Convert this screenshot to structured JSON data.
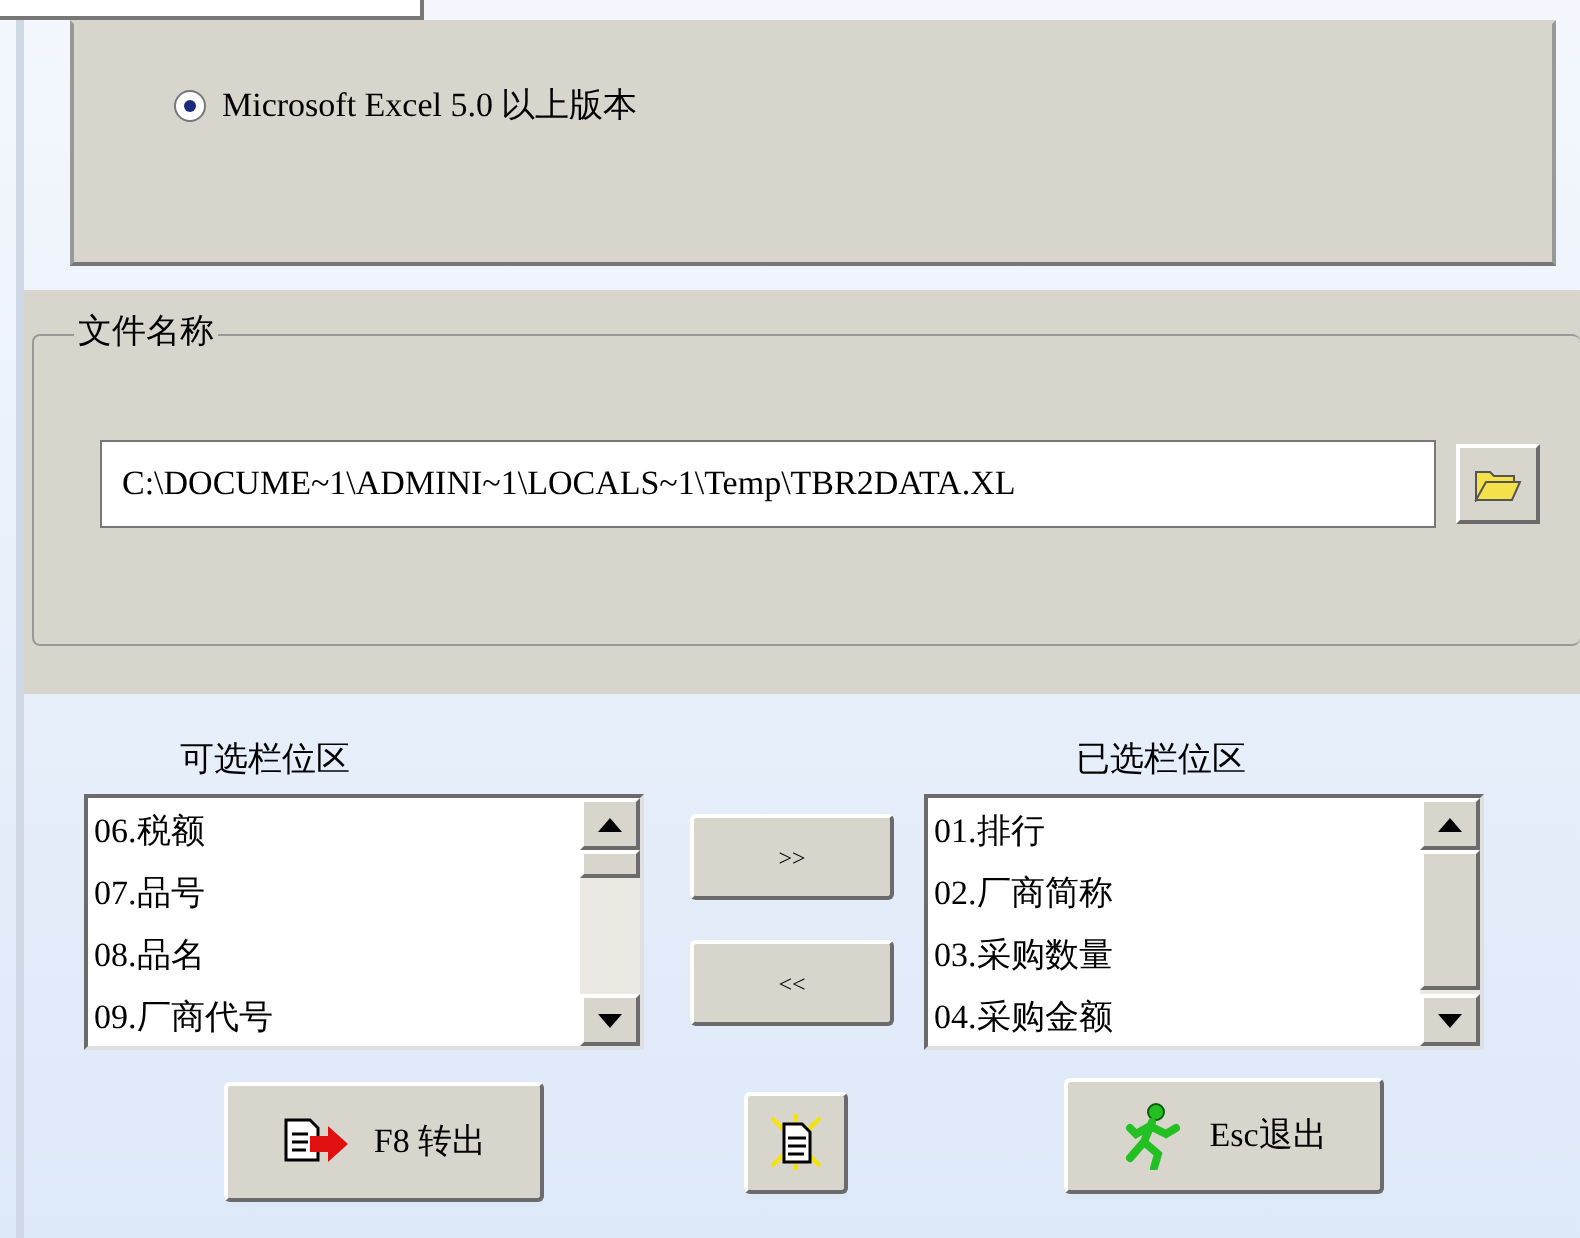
{
  "export_format": {
    "options": [
      {
        "label": "Microsoft Excel 5.0 以上版本",
        "selected": true
      }
    ]
  },
  "file_name": {
    "legend": "文件名称",
    "value": "C:\\DOCUME~1\\ADMINI~1\\LOCALS~1\\Temp\\TBR2DATA.XL"
  },
  "available_columns": {
    "title": "可选栏位区",
    "items": [
      "06.税额",
      "07.品号",
      "08.品名",
      "09.厂商代号"
    ]
  },
  "selected_columns": {
    "title": "已选栏位区",
    "items": [
      "01.排行",
      "02.厂商简称",
      "03.采购数量",
      "04.采购金额"
    ]
  },
  "move_buttons": [
    ">>",
    "<<"
  ],
  "actions": [
    {
      "kind": "export",
      "label": "F8 转出"
    },
    {
      "kind": "icon"
    },
    {
      "kind": "exit",
      "label": "Esc退出"
    }
  ]
}
